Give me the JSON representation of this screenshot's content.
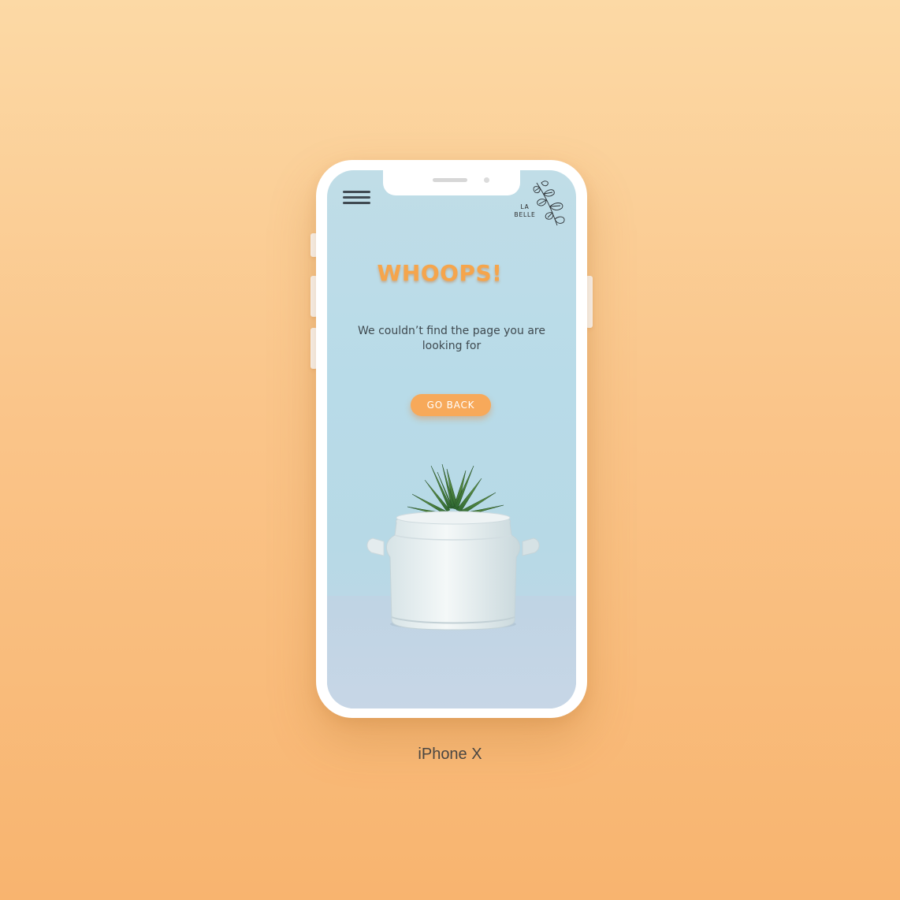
{
  "device_label": "iPhone X",
  "header": {
    "menu_icon": "hamburger-menu-icon",
    "logo_text_line1": "LA",
    "logo_text_line2": "BELLE",
    "logo_icon": "leaf-branch-icon"
  },
  "error_page": {
    "headline": "WHOOPS!",
    "message": "We couldn’t find the page you are looking for",
    "button_label": "GO BACK"
  },
  "illustration": "succulent-in-white-pot",
  "colors": {
    "background_top": "#fcd9a5",
    "background_bottom": "#f8b46f",
    "screen_bg": "#b8dbe8",
    "accent": "#f5a54c",
    "button": "#f7a95a",
    "text": "#3f4a50"
  }
}
